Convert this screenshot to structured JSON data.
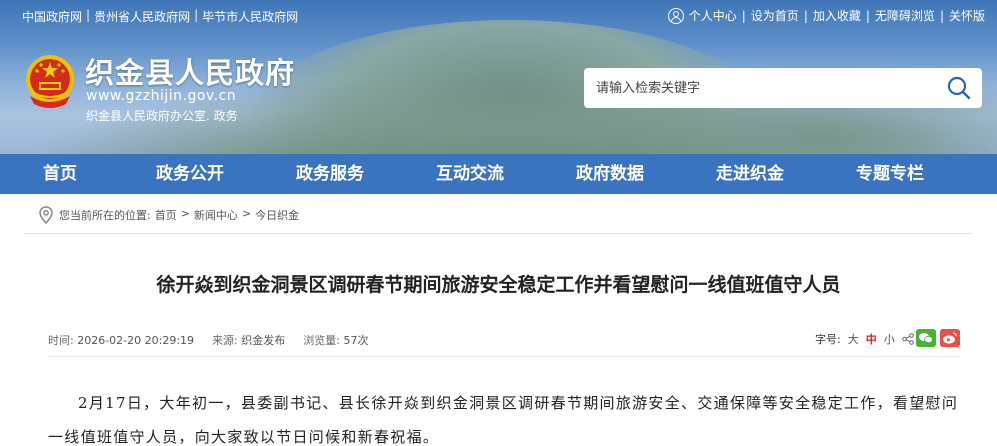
{
  "top_links": [
    "中国政府网",
    "贵州省人民政府网",
    "毕节市人民政府网"
  ],
  "top_right": [
    "个人中心",
    "设为首页",
    "加入收藏",
    "无障碍浏览",
    "关怀版"
  ],
  "site": {
    "title": "织金县人民政府",
    "url": "www.gzzhijin.gov.cn",
    "subtitle": "织金县人民政府办公室. 政务"
  },
  "search": {
    "placeholder": "请输入检索关键字"
  },
  "nav": [
    "首页",
    "政务公开",
    "政务服务",
    "互动交流",
    "政府数据",
    "走进织金",
    "专题专栏"
  ],
  "breadcrumb": {
    "prefix": "您当前所在的位置:",
    "items": [
      "首页",
      "新闻中心",
      "今日织金"
    ],
    "sep": ">"
  },
  "article": {
    "title": "徐开焱到织金洞景区调研春节期间旅游安全稳定工作并看望慰问一线值班值守人员",
    "time_label": "时间:",
    "time": "2026-02-20 20:29:19",
    "source_label": "来源:",
    "source": "织金发布",
    "views_label": "浏览量:",
    "views": "57次",
    "font_label": "字号:",
    "font_sizes": [
      "大",
      "中",
      "小"
    ],
    "body": "2月17日，大年初一，县委副书记、县长徐开焱到织金洞景区调研春节期间旅游安全、交通保障等安全稳定工作，看望慰问一线值班值守人员，向大家致以节日问候和新春祝福。"
  },
  "colors": {
    "nav_bg": "#3a73bf",
    "accent_red": "#d6202b",
    "wechat": "#49b233",
    "weibo": "#e8514b"
  }
}
